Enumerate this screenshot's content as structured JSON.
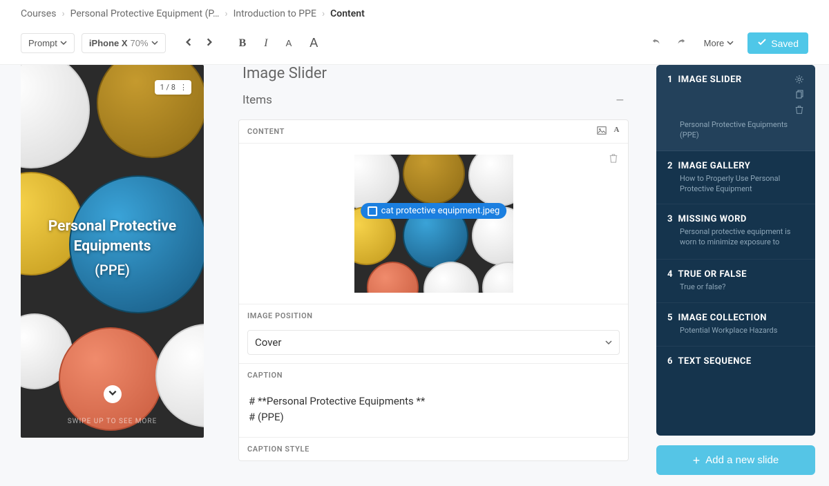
{
  "breadcrumb": {
    "root": "Courses",
    "course": "Personal Protective Equipment (P…",
    "lesson": "Introduction to PPE",
    "page": "Content"
  },
  "toolbar": {
    "prompt": "Prompt",
    "device": "iPhone X",
    "zoom": "70%",
    "more": "More",
    "saved": "Saved"
  },
  "preview": {
    "badge": "1 / 8",
    "title": "Personal Protective Equipments",
    "subtitle": "(PPE)",
    "hint": "SWIPE UP TO SEE MORE"
  },
  "editor": {
    "title": "Image Slider",
    "items_label": "Items",
    "content_label": "CONTENT",
    "filename": "cat protective equipment.jpeg",
    "img_pos_label": "IMAGE POSITION",
    "img_pos_value": "Cover",
    "caption_label": "CAPTION",
    "caption_line1": "# **Personal Protective Equipments **",
    "caption_line2": "# (PPE)",
    "caption_style_label": "CAPTION STYLE"
  },
  "slides": [
    {
      "num": "1",
      "title": "IMAGE SLIDER",
      "desc": "Personal Protective Equipments (PPE)"
    },
    {
      "num": "2",
      "title": "IMAGE GALLERY",
      "desc": "How to Properly Use Personal Protective Equipment"
    },
    {
      "num": "3",
      "title": "MISSING WORD",
      "desc": "Personal protective equipment is worn to minimize exposure to hazards that cause serious workplace injuries and…"
    },
    {
      "num": "4",
      "title": "TRUE OR FALSE",
      "desc": "True or false?"
    },
    {
      "num": "5",
      "title": "IMAGE COLLECTION",
      "desc": "Potential Workplace Hazards"
    },
    {
      "num": "6",
      "title": "TEXT SEQUENCE",
      "desc": ""
    }
  ],
  "add_slide": "Add a new slide"
}
